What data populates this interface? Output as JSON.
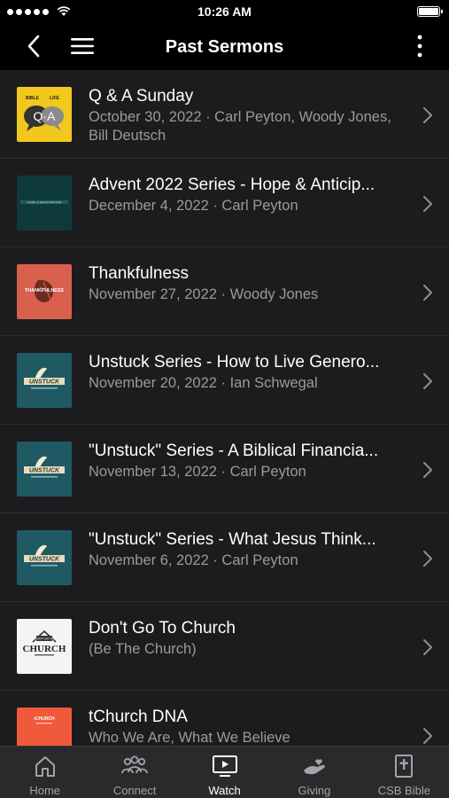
{
  "status_bar": {
    "time": "10:26 AM"
  },
  "nav": {
    "title": "Past Sermons"
  },
  "sermons": [
    {
      "title": "Q & A Sunday",
      "subtitle": "October 30, 2022 · Carl Peyton, Woody Jones, Bill Deutsch",
      "thumb_text": "Q·A",
      "thumb_top_left": "BIBLE",
      "thumb_top_right": "LIFE"
    },
    {
      "title": "Advent 2022 Series - Hope & Anticip...",
      "subtitle": "December 4, 2022 · Carl Peyton",
      "thumb_text": "HOPE & ANTICIPATION"
    },
    {
      "title": "Thankfulness",
      "subtitle": "November 27, 2022 · Woody Jones",
      "thumb_text": "THANKFULNESS"
    },
    {
      "title": "Unstuck Series - How to Live Genero...",
      "subtitle": "November 20, 2022 · Ian Schwegal",
      "thumb_text": "UNSTUCK"
    },
    {
      "title": "\"Unstuck\" Series - A Biblical Financia...",
      "subtitle": "November 13, 2022 · Carl Peyton",
      "thumb_text": "UNSTUCK"
    },
    {
      "title": "\"Unstuck\" Series - What Jesus Think...",
      "subtitle": "November 6, 2022 · Carl Peyton",
      "thumb_text": "UNSTUCK"
    },
    {
      "title": "Don't Go To Church",
      "subtitle": "(Be The Church)",
      "thumb_top": "DON'T GO TO",
      "thumb_text": "CHURCH"
    },
    {
      "title": "tChurch DNA",
      "subtitle": "Who We Are, What We Believe",
      "thumb_text": "tCHURCH"
    }
  ],
  "tabs": [
    {
      "label": "Home",
      "icon": "home-icon"
    },
    {
      "label": "Connect",
      "icon": "people-icon"
    },
    {
      "label": "Watch",
      "icon": "tv-play-icon",
      "active": true
    },
    {
      "label": "Giving",
      "icon": "hand-heart-icon"
    },
    {
      "label": "CSB Bible",
      "icon": "bible-icon"
    }
  ],
  "colors": {
    "background": "#1c1c1e",
    "bar": "#000000",
    "tabbar": "#2a2a2d",
    "subtitle": "#9a9a9f",
    "qa_yellow": "#f2c81c",
    "thankful_red": "#d9604c",
    "unstuck_teal": "#1f5a64",
    "tchurch_orange": "#f05a3a"
  }
}
